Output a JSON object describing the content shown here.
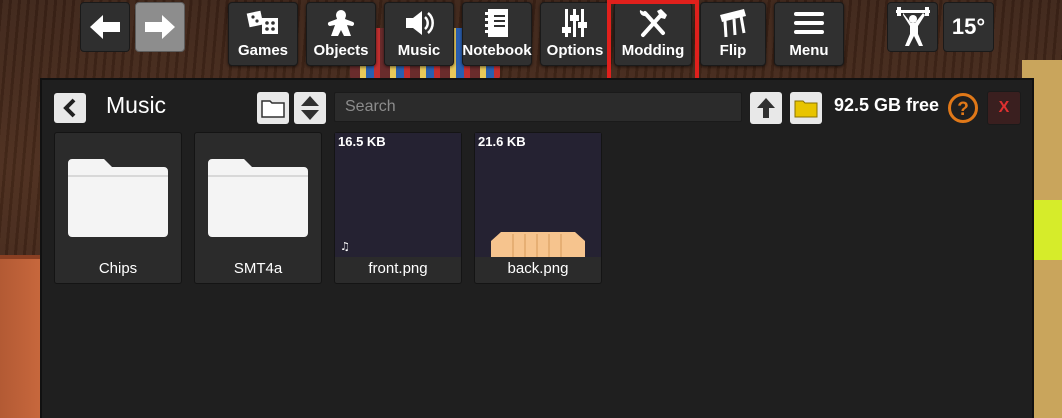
{
  "toolbar": {
    "back_icon": "arrow-left-icon",
    "forward_icon": "arrow-right-icon",
    "buttons": [
      {
        "label": "Games",
        "icon": "dice-icon"
      },
      {
        "label": "Objects",
        "icon": "meeple-icon"
      },
      {
        "label": "Music",
        "icon": "speaker-icon"
      },
      {
        "label": "Notebook",
        "icon": "notebook-icon"
      },
      {
        "label": "Options",
        "icon": "sliders-icon"
      },
      {
        "label": "Modding",
        "icon": "tools-icon"
      },
      {
        "label": "Flip",
        "icon": "flip-table-icon"
      },
      {
        "label": "Menu",
        "icon": "hamburger-icon"
      }
    ],
    "lift_icon": "weightlifter-icon",
    "rotation_angle": "15°",
    "highlight_color": "#e0201c"
  },
  "browser": {
    "title": "Music",
    "search_placeholder": "Search",
    "free_space": "92.5 GB free",
    "help_label": "?",
    "close_label": "X",
    "accent_color": "#e07818",
    "items": [
      {
        "name": "Chips",
        "type": "folder"
      },
      {
        "name": "SMT4a",
        "type": "folder"
      },
      {
        "name": "front.png",
        "type": "image",
        "size": "16.5 KB",
        "badge": "♫"
      },
      {
        "name": "back.png",
        "type": "image",
        "size": "21.6 KB"
      }
    ]
  }
}
